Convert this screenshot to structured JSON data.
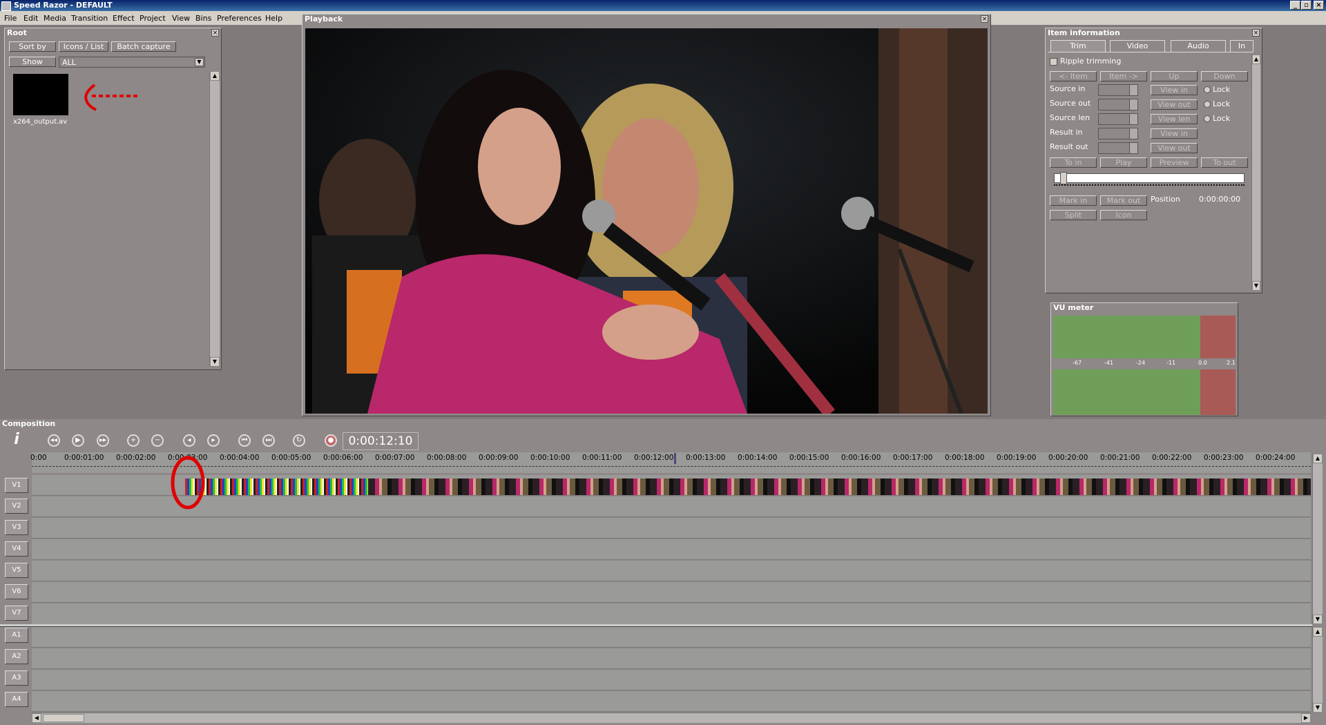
{
  "window": {
    "title": "Speed Razor - DEFAULT",
    "min_label": "_",
    "max_label": "▫",
    "close_label": "×"
  },
  "menubar": {
    "items": [
      "File",
      "Edit",
      "Media",
      "Transition",
      "Effect",
      "Project",
      "View",
      "Bins",
      "Preferences",
      "Help"
    ]
  },
  "bin": {
    "title": "Root",
    "buttons": {
      "sort": "Sort by",
      "icons_list": "Icons / List",
      "batch": "Batch capture",
      "show": "Show"
    },
    "filter_value": "ALL",
    "items": [
      {
        "name": "x264_output.av"
      }
    ]
  },
  "playback": {
    "title": "Playback"
  },
  "item_info": {
    "title": "Item information",
    "tabs": [
      "Trim",
      "Video",
      "Audio",
      "In"
    ],
    "ripple_label": "Ripple trimming",
    "nav_buttons": [
      "<- Item",
      "Item ->",
      "Up",
      "Down"
    ],
    "fields": [
      {
        "label": "Source in",
        "view": "View in",
        "lock": "Lock"
      },
      {
        "label": "Source out",
        "view": "View out",
        "lock": "Lock"
      },
      {
        "label": "Source len",
        "view": "View len",
        "lock": "Lock"
      },
      {
        "label": "Result in",
        "view": "View in",
        "lock": ""
      },
      {
        "label": "Result out",
        "view": "View out",
        "lock": ""
      }
    ],
    "action_buttons": [
      "To in",
      "Play",
      "Preview",
      "To out"
    ],
    "mark_in": "Mark in",
    "mark_out": "Mark out",
    "position_label": "Position",
    "position_value": "0:00:00:00",
    "split": "Split",
    "icon": "Icon"
  },
  "vu_meter": {
    "title": "VU meter",
    "scale": [
      "-67",
      "-41",
      "-24",
      "-11",
      "0.0",
      "2.1"
    ]
  },
  "composition": {
    "title": "Composition",
    "timecode": "0:00:12:10",
    "ruler": [
      "0:00",
      "0:00:01:00",
      "0:00:02:00",
      "0:00:03:00",
      "0:00:04:00",
      "0:00:05:00",
      "0:00:06:00",
      "0:00:07:00",
      "0:00:08:00",
      "0:00:09:00",
      "0:00:10:00",
      "0:00:11:00",
      "0:00:12:00",
      "0:00:13:00",
      "0:00:14:00",
      "0:00:15:00",
      "0:00:16:00",
      "0:00:17:00",
      "0:00:18:00",
      "0:00:19:00",
      "0:00:20:00",
      "0:00:21:00",
      "0:00:22:00",
      "0:00:23:00",
      "0:00:24:00"
    ],
    "video_tracks": [
      "V1",
      "V2",
      "V3",
      "V4",
      "V5",
      "V6",
      "V7"
    ],
    "audio_tracks": [
      "A1",
      "A2",
      "A3",
      "A4"
    ]
  },
  "colors": {
    "panel": "#8e8888",
    "vu_green": "#6e9e58",
    "vu_red": "#a85a56",
    "annotation": "#e00000"
  }
}
